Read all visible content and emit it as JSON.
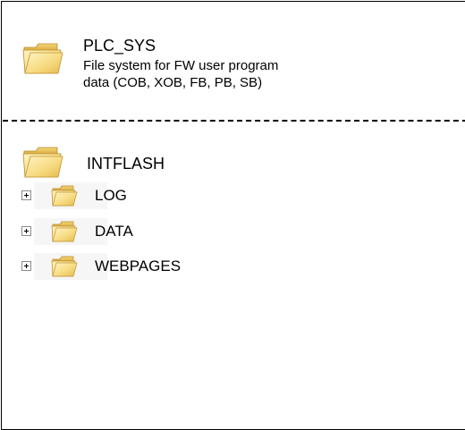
{
  "colors": {
    "folder_light": "#fbe9a6",
    "folder_mid": "#f2cf6a",
    "folder_dark": "#c99a2e",
    "separator": "#000000"
  },
  "plc_sys": {
    "title": "PLC_SYS",
    "description_line1": "File system for FW user program",
    "description_line2": "data (COB, XOB, FB, PB, SB)",
    "icon": "folder-icon"
  },
  "intflash": {
    "title": "INTFLASH",
    "icon": "folder-icon",
    "children": [
      {
        "label": "LOG",
        "icon": "folder-icon",
        "expander": "plus-box-icon"
      },
      {
        "label": "DATA",
        "icon": "folder-icon",
        "expander": "plus-box-icon"
      },
      {
        "label": "WEBPAGES",
        "icon": "folder-icon",
        "expander": "plus-box-icon"
      }
    ]
  }
}
